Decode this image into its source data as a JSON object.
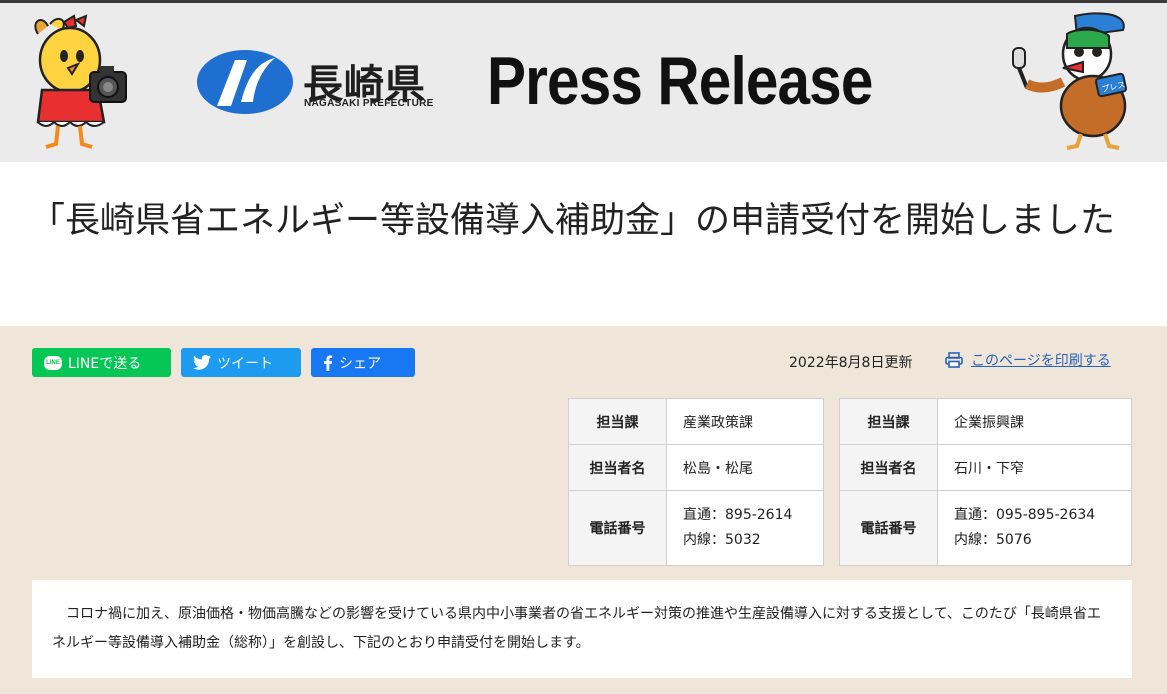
{
  "header": {
    "logo_name": "長崎県",
    "logo_en": "NAGASAKI PREFECTURE",
    "title": "Press Release",
    "mascot_right_badge": "プレス",
    "colors": {
      "logo_blue": "#1f6fd1",
      "header_bg": "#ebebeb"
    }
  },
  "page_title": "「長崎県省エネルギー等設備導入補助金」の申請受付を開始しました",
  "share": {
    "line_label": "LINEで送る",
    "line_badge": "LINE",
    "tweet_label": "ツイート",
    "facebook_label": "シェア",
    "colors": {
      "line": "#06c755",
      "twitter": "#1d9bf0",
      "facebook": "#1877f2"
    }
  },
  "updated": "2022年8月8日更新",
  "print_label": "このページを印刷する",
  "contacts": [
    {
      "dept_label": "担当課",
      "dept": "産業政策課",
      "person_label": "担当者名",
      "person": "松島・松尾",
      "phone_label": "電話番号",
      "phone_direct": "直通：895-2614",
      "phone_ext": "内線：5032"
    },
    {
      "dept_label": "担当課",
      "dept": "企業振興課",
      "person_label": "担当者名",
      "person": "石川・下窄",
      "phone_label": "電話番号",
      "phone_direct": "直通：095-895-2634",
      "phone_ext": "内線：5076"
    }
  ],
  "body": "コロナ禍に加え、原油価格・物価高騰などの影響を受けている県内中小事業者の省エネルギー対策の推進や生産設備導入に対する支援として、このたび「長崎県省エネルギー等設備導入補助金（総称）」を創設し、下記のとおり申請受付を開始します。"
}
